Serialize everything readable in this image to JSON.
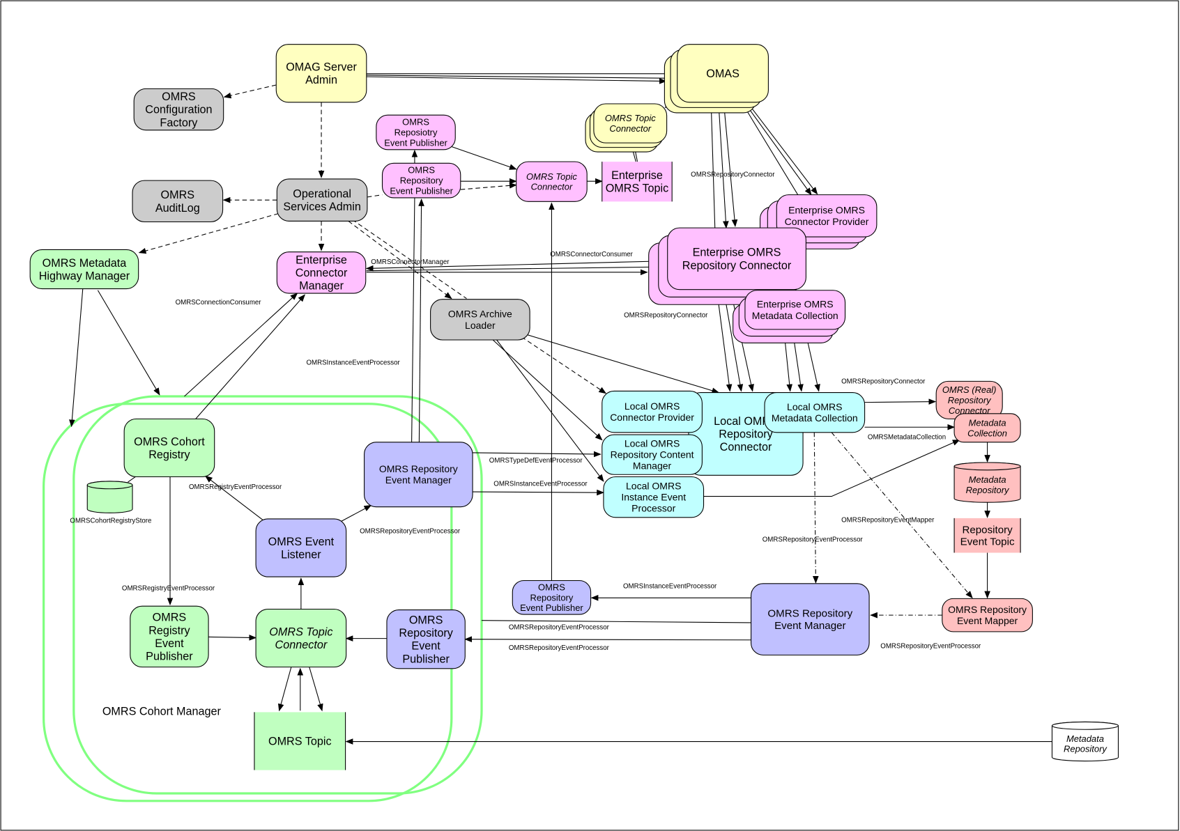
{
  "palette": {
    "yellow": "#ffffc0",
    "grey": "#cccccc",
    "green": "#c0ffc0",
    "pink": "#ffc0ff",
    "cyan": "#c0ffff",
    "purple": "#c0c0ff",
    "red": "#ffc0c0",
    "cohort_outline": "#80ff80"
  },
  "nodes": {
    "omag": [
      "OMAG Server",
      "Admin"
    ],
    "config_factory": [
      "OMRS",
      "Configuration",
      "Factory"
    ],
    "auditlog": [
      "OMRS",
      "AuditLog"
    ],
    "ops_admin": [
      "Operational",
      "Services Admin"
    ],
    "highway": [
      "OMRS Metadata",
      "Highway Manager"
    ],
    "ecm": [
      "Enterprise",
      "Connector",
      "Manager"
    ],
    "pub_top": [
      "OMRS",
      "Reposiotry",
      "Event Publisher"
    ],
    "pub_mid": [
      "OMRS",
      "Repository",
      "Event Publisher"
    ],
    "topic_conn_pink": [
      "OMRS Topic",
      "Connector"
    ],
    "ent_topic": [
      "Enterprise",
      "OMRS Topic"
    ],
    "omas": [
      "OMAS"
    ],
    "topic_conn_yellow": [
      "OMRS Topic",
      "Connector"
    ],
    "ent_conn_provider": [
      "Enterprise OMRS",
      "Connector Provider"
    ],
    "ent_repo_conn": [
      "Enterprise OMRS",
      "Repository Connector"
    ],
    "ent_md_coll": [
      "Enterprise OMRS",
      "Metadata Collection"
    ],
    "archive": [
      "OMRS Archive",
      "Loader"
    ],
    "local_repo_conn": [
      "Local OMRS",
      "Repository",
      "Connector"
    ],
    "local_conn_provider": [
      "Local OMRS",
      "Connector Provider"
    ],
    "local_content_mgr": [
      "Local OMRS",
      "Repository Content",
      "Manager"
    ],
    "local_instance_proc": [
      "Local OMRS",
      "Instance Event",
      "Processor"
    ],
    "local_md_coll": [
      "Local OMRS",
      "Metadata Collection"
    ],
    "real_repo_conn": [
      "OMRS (Real)",
      "Repository",
      "Connector"
    ],
    "md_collection": [
      "Metadata",
      "Collection"
    ],
    "md_repository": [
      "Metadata",
      "Repository"
    ],
    "repo_event_topic": [
      "Repository",
      "Event Topic"
    ],
    "event_mapper": [
      "OMRS Repository",
      "Event Mapper"
    ],
    "rem_right": [
      "OMRS Repository",
      "Event Manager"
    ],
    "pub_small": [
      "OMRS",
      "Repository",
      "Event Publisher"
    ],
    "md_repository_ext": [
      "Metadata",
      "Repository"
    ],
    "cohort_registry": [
      "OMRS Cohort",
      "Registry"
    ],
    "rem_left": [
      "OMRS Repository",
      "Event Manager"
    ],
    "event_listener": [
      "OMRS Event",
      "Listener"
    ],
    "registry_pub": [
      "OMRS",
      "Registry",
      "Event",
      "Publisher"
    ],
    "topic_conn_green": [
      "OMRS Topic",
      "Connector"
    ],
    "repo_pub_green": [
      "OMRS",
      "Repository",
      "Event",
      "Publisher"
    ],
    "omrs_topic": [
      "OMRS Topic"
    ],
    "cohort_store": []
  },
  "cohort_manager_label": "OMRS Cohort Manager",
  "edge_labels": [
    "OMRSRepositoryConnector",
    "OMRSConnectorManager",
    "OMRSConnectorConsumer",
    "OMRSConnectionConsumer",
    "OMRSRepositoryConnector",
    "OMRSInstanceEventProcessor",
    "OMRSRepositoryConnector",
    "OMRSMetadataCollection",
    "OMRSTypeDefEventProcessor",
    "OMRSInstanceEventProcessor",
    "OMRSRegistryEventProcessor",
    "OMRSCohortRegistryStore",
    "OMRSRepositoryEventProcessor",
    "OMRSRepositoryEventMapper",
    "OMRSRepositoryEventProcessor",
    "OMRSRegistryEventProcessor",
    "OMRSInstanceEventProcessor",
    "OMRSRepositoryEventProcessor",
    "OMRSRepositoryEventProcessor",
    "OMRSRepositoryEventProcessor"
  ]
}
